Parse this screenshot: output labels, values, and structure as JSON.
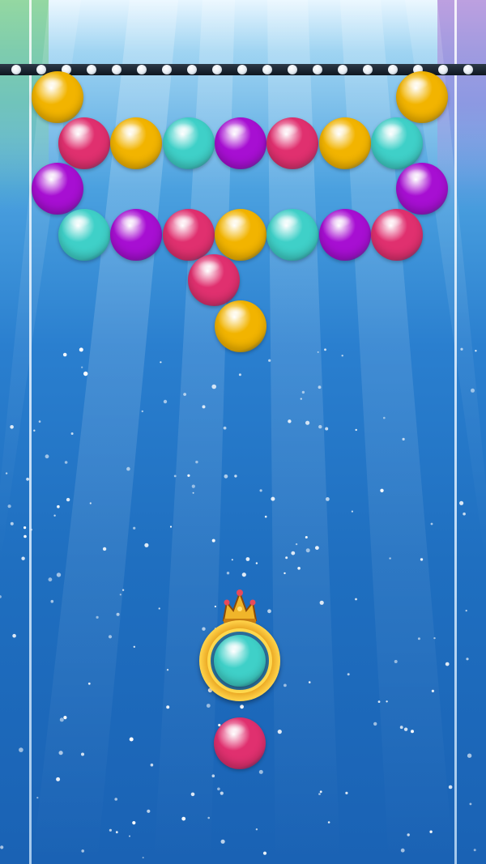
{
  "game": {
    "colors": {
      "yellow": "#f2b400",
      "pink": "#e0306f",
      "cyan": "#3fd0c8",
      "purple": "#a70fd2",
      "background_top": "#9fd4f2",
      "background_bottom": "#1a62b4"
    },
    "grid": [
      [
        {
          "c": "yellow"
        },
        null,
        null,
        null,
        null,
        null,
        null,
        {
          "c": "yellow"
        }
      ],
      [
        {
          "c": "pink"
        },
        {
          "c": "yellow"
        },
        {
          "c": "cyan"
        },
        {
          "c": "purple"
        },
        {
          "c": "pink"
        },
        {
          "c": "yellow"
        },
        {
          "c": "cyan"
        }
      ],
      [
        {
          "c": "purple"
        },
        null,
        null,
        null,
        null,
        null,
        null,
        {
          "c": "purple"
        }
      ],
      [
        {
          "c": "cyan"
        },
        {
          "c": "purple"
        },
        {
          "c": "pink"
        },
        {
          "c": "yellow"
        },
        {
          "c": "cyan"
        },
        {
          "c": "purple"
        },
        {
          "c": "pink"
        }
      ],
      [
        null,
        null,
        null,
        {
          "c": "pink"
        },
        null,
        null,
        null,
        null
      ],
      [
        null,
        null,
        null,
        {
          "c": "yellow"
        },
        null,
        null,
        null
      ]
    ],
    "shooter": {
      "current_bubble": "cyan",
      "next_bubble": "pink",
      "launcher_icon": "crown-icon"
    }
  }
}
